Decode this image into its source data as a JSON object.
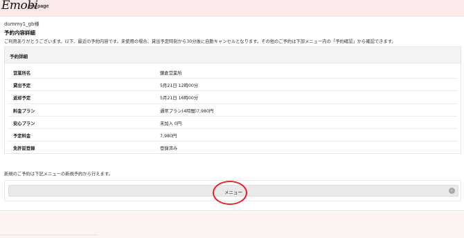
{
  "header": {
    "logo_script": "Emobi",
    "logo_sub": "my page"
  },
  "user": {
    "name": "dummy1_gb様"
  },
  "page": {
    "title": "予約内容詳細",
    "thanks": "ご利用ありがとうございます。以下、最近の予約内容です。未使用の場合、貸出予定時刻から30分後に自動キャンセルとなります。その他のご予約は下部メニュー内の「予約確認」から確認できます。"
  },
  "details": {
    "header": "予約詳細",
    "rows": [
      {
        "label": "営業所名",
        "value": "鎌倉営業所"
      },
      {
        "label": "貸出予定",
        "value": "5月21日 12時00分"
      },
      {
        "label": "返却予定",
        "value": "5月21日 16時00分"
      },
      {
        "label": "料金プラン",
        "value": "通常プラン(4時間)7,980円"
      },
      {
        "label": "安心プラン",
        "value": "未加入 0円"
      },
      {
        "label": "予定料金",
        "value": "7,980円"
      },
      {
        "label": "免許証登録",
        "value": "登録済み"
      }
    ]
  },
  "new_booking_note": "新規のご予約は下記メニューの新規予約から行えます。",
  "menu": {
    "label": "メニュー",
    "icon": "chevron-right-icon"
  },
  "annotation": {
    "color": "#e4261f"
  }
}
